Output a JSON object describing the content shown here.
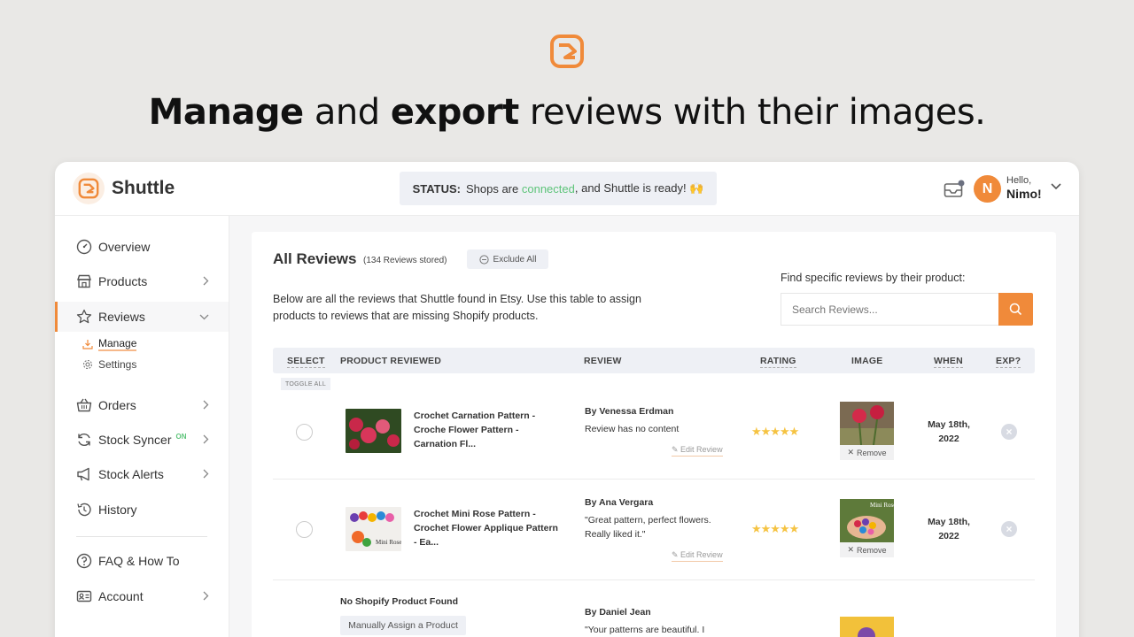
{
  "hero": {
    "headline_bold_1": "Manage",
    "headline_mid": " and ",
    "headline_bold_2": "export",
    "headline_end": " reviews with their images."
  },
  "topbar": {
    "brand": "Shuttle",
    "status_label": "STATUS:",
    "status_pre": "Shops are ",
    "status_ok": "connected",
    "status_post": ", and Shuttle is ready! 🙌",
    "avatar_initial": "N",
    "hello": "Hello,",
    "user_name": "Nimo!"
  },
  "sidebar": {
    "overview": "Overview",
    "products": "Products",
    "reviews": "Reviews",
    "manage": "Manage",
    "settings": "Settings",
    "orders": "Orders",
    "stock_syncer": "Stock Syncer",
    "stock_syncer_badge": "ON",
    "stock_alerts": "Stock Alerts",
    "history": "History",
    "faq": "FAQ & How To",
    "account": "Account"
  },
  "main": {
    "title": "All Reviews",
    "count": "(134 Reviews stored)",
    "exclude_all": "Exclude All",
    "description": "Below are all the reviews that Shuttle found in Etsy. Use this table to assign products to reviews that are missing Shopify products.",
    "find_label": "Find specific reviews by their product:",
    "search_placeholder": "Search Reviews...",
    "toggle_all": "TOGGLE ALL",
    "columns": {
      "select": "SELECT",
      "product": "PRODUCT REVIEWED",
      "review": "REVIEW",
      "rating": "RATING",
      "image": "IMAGE",
      "when": "WHEN",
      "exp": "EXP?"
    },
    "rows": [
      {
        "product": "Crochet Carnation Pattern - Croche Flower Pattern - Carnation Fl...",
        "by": "By Venessa Erdman",
        "text": "Review has no content",
        "edit": "Edit Review",
        "rating": 5,
        "remove": "Remove",
        "when": "May 18th, 2022"
      },
      {
        "product": "Crochet Mini Rose Pattern - Crochet Flower Applique Pattern - Ea...",
        "by": "By Ana Vergara",
        "text": "\"Great pattern, perfect flowers. Really liked it.\"",
        "edit": "Edit Review",
        "rating": 5,
        "remove": "Remove",
        "when": "May 18th, 2022"
      },
      {
        "no_product": "No Shopify Product Found",
        "assign": "Manually Assign a Product",
        "by": "By Daniel Jean",
        "text": "\"Your patterns are beautiful. I"
      }
    ]
  },
  "colors": {
    "accent": "#f08a3a",
    "connected": "#5ec47a",
    "star": "#f5c342"
  }
}
